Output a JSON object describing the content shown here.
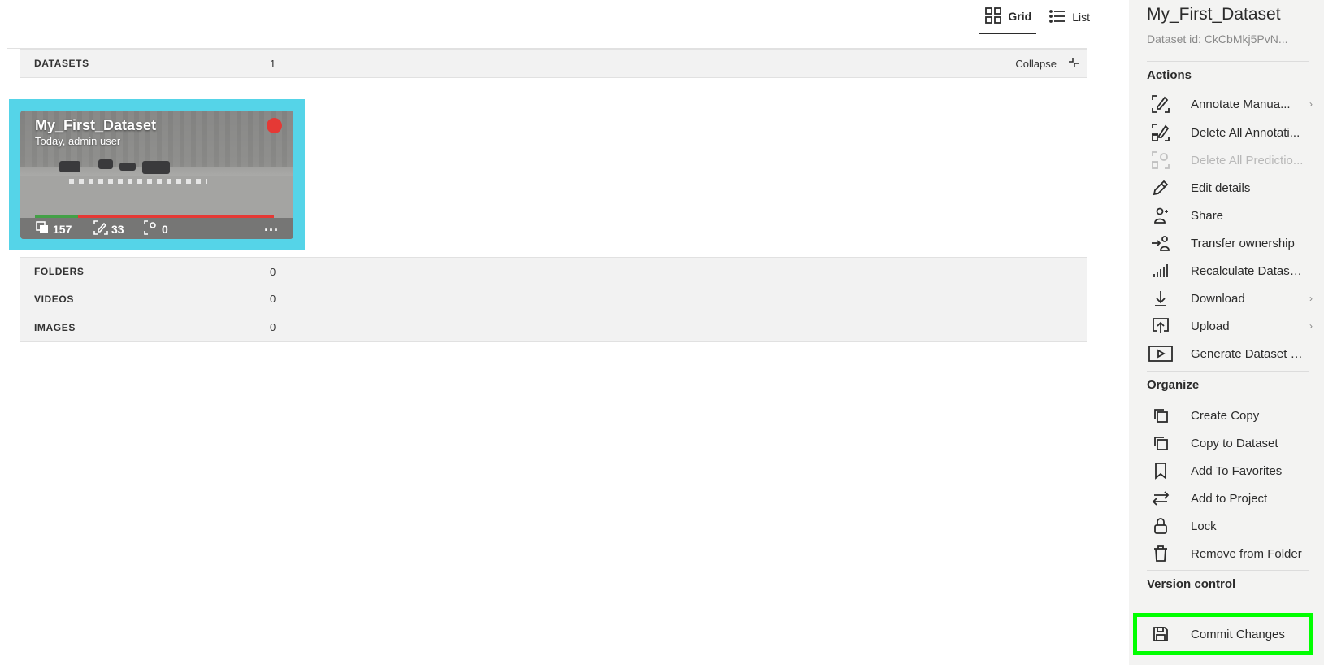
{
  "view_toggle": {
    "grid_label": "Grid",
    "list_label": "List"
  },
  "sections": {
    "datasets": {
      "label": "DATASETS",
      "count": "1",
      "collapse_label": "Collapse"
    },
    "folders": {
      "label": "FOLDERS",
      "count": "0"
    },
    "videos": {
      "label": "VIDEOS",
      "count": "0"
    },
    "images": {
      "label": "IMAGES",
      "count": "0"
    }
  },
  "card": {
    "title": "My_First_Dataset",
    "subtitle": "Today, admin user",
    "images_count": "157",
    "annotations_count": "33",
    "predictions_count": "0",
    "more": "...",
    "progress_fraction": 0.18,
    "status_color": "#e53935"
  },
  "panel": {
    "title": "My_First_Dataset",
    "dataset_id": "Dataset id: CkCbMkj5PvN...",
    "actions_heading": "Actions",
    "actions": [
      {
        "label": "Annotate Manua...",
        "icon": "annotate-icon",
        "chevron": "›"
      },
      {
        "label": "Delete All Annotati...",
        "icon": "delete-annotations-icon"
      },
      {
        "label": "Delete All Predictio...",
        "icon": "delete-predictions-icon",
        "disabled": true
      },
      {
        "label": "Edit details",
        "icon": "pencil-icon"
      },
      {
        "label": "Share",
        "icon": "share-user-icon"
      },
      {
        "label": "Transfer ownership",
        "icon": "transfer-icon"
      },
      {
        "label": "Recalculate Datase...",
        "icon": "bar-chart-icon"
      },
      {
        "label": "Download",
        "icon": "download-icon",
        "chevron": "›"
      },
      {
        "label": "Upload",
        "icon": "upload-icon",
        "chevron": "›"
      },
      {
        "label": "Generate Dataset P...",
        "icon": "play-icon"
      }
    ],
    "organize_heading": "Organize",
    "organize": [
      {
        "label": "Create Copy",
        "icon": "copy-icon"
      },
      {
        "label": "Copy to Dataset",
        "icon": "copy-icon"
      },
      {
        "label": "Add To Favorites",
        "icon": "bookmark-icon"
      },
      {
        "label": "Add to Project",
        "icon": "swap-arrows-icon"
      },
      {
        "label": "Lock",
        "icon": "lock-icon"
      },
      {
        "label": "Remove from Folder",
        "icon": "trash-icon"
      }
    ],
    "version_heading": "Version control",
    "version": [
      {
        "label": "Commit Changes",
        "icon": "save-icon"
      }
    ]
  },
  "colors": {
    "card_highlight": "#55d4e8",
    "panel_bg": "#f3f3f2",
    "commit_highlight": "#00ff00",
    "progress_done": "#43a047",
    "progress_rest": "#e53935"
  }
}
